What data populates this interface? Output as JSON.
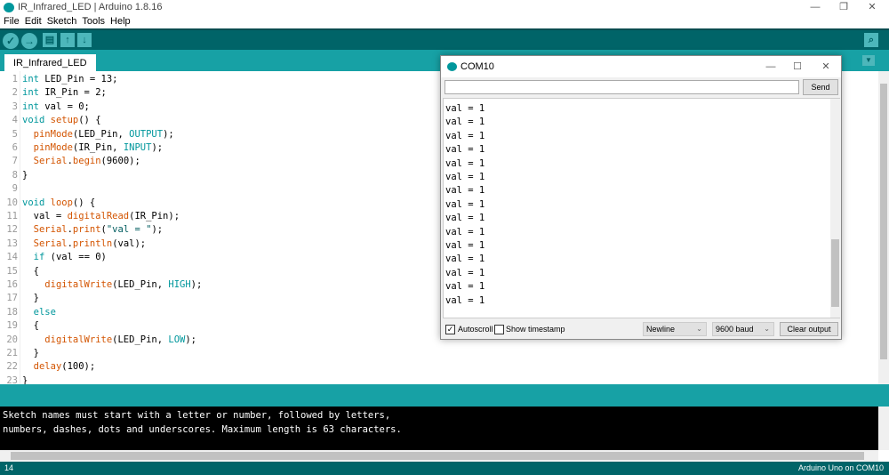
{
  "window": {
    "title": "IR_Infrared_LED | Arduino 1.8.16"
  },
  "menu": [
    "File",
    "Edit",
    "Sketch",
    "Tools",
    "Help"
  ],
  "toolbar": {
    "verify": "✓",
    "upload": "→",
    "new": "▤",
    "open": "↑",
    "save": "↓",
    "serial_monitor": "⌕"
  },
  "tab": {
    "label": "IR_Infrared_LED",
    "menu": "▼"
  },
  "code": [
    [
      [
        "k",
        "int"
      ],
      [
        "",
        "LED_Pin = 13;"
      ]
    ],
    [
      [
        "k",
        "int"
      ],
      [
        "",
        "IR_Pin = 2;"
      ]
    ],
    [
      [
        "k",
        "int"
      ],
      [
        "",
        "val = 0;"
      ]
    ],
    [
      [
        "k",
        "void"
      ],
      [
        "",
        " "
      ],
      [
        "f",
        "setup"
      ],
      [
        "",
        "() {"
      ]
    ],
    [
      [
        "",
        "  "
      ],
      [
        "f",
        "pinMode"
      ],
      [
        "",
        "(LED_Pin, "
      ],
      [
        "c",
        "OUTPUT"
      ],
      [
        "",
        ");"
      ]
    ],
    [
      [
        "",
        "  "
      ],
      [
        "f",
        "pinMode"
      ],
      [
        "",
        "(IR_Pin, "
      ],
      [
        "c",
        "INPUT"
      ],
      [
        "",
        ");"
      ]
    ],
    [
      [
        "",
        "  "
      ],
      [
        "f",
        "Serial"
      ],
      [
        "",
        "."
      ],
      [
        "f",
        "begin"
      ],
      [
        "",
        "(9600);"
      ]
    ],
    [
      [
        "",
        "}"
      ]
    ],
    [],
    [
      [
        "k",
        "void"
      ],
      [
        "",
        " "
      ],
      [
        "f",
        "loop"
      ],
      [
        "",
        "() {"
      ]
    ],
    [
      [
        "",
        "  val = "
      ],
      [
        "f",
        "digitalRead"
      ],
      [
        "",
        "(IR_Pin);"
      ]
    ],
    [
      [
        "",
        "  "
      ],
      [
        "f",
        "Serial"
      ],
      [
        "",
        "."
      ],
      [
        "f",
        "print"
      ],
      [
        "",
        "("
      ],
      [
        "s",
        "\"val = \""
      ],
      [
        "",
        ");"
      ]
    ],
    [
      [
        "",
        "  "
      ],
      [
        "f",
        "Serial"
      ],
      [
        "",
        "."
      ],
      [
        "f",
        "println"
      ],
      [
        "",
        "(val);"
      ]
    ],
    [
      [
        "",
        "  "
      ],
      [
        "k",
        "if"
      ],
      [
        "",
        " (val == 0)"
      ]
    ],
    [
      [
        "",
        "  {"
      ]
    ],
    [
      [
        "",
        "    "
      ],
      [
        "f",
        "digitalWrite"
      ],
      [
        "",
        "(LED_Pin, "
      ],
      [
        "c",
        "HIGH"
      ],
      [
        "",
        ");"
      ]
    ],
    [
      [
        "",
        "  }"
      ]
    ],
    [
      [
        "",
        "  "
      ],
      [
        "k",
        "else"
      ]
    ],
    [
      [
        "",
        "  {"
      ]
    ],
    [
      [
        "",
        "    "
      ],
      [
        "f",
        "digitalWrite"
      ],
      [
        "",
        "(LED_Pin, "
      ],
      [
        "c",
        "LOW"
      ],
      [
        "",
        ");"
      ]
    ],
    [
      [
        "",
        "  }"
      ]
    ],
    [
      [
        "",
        "  "
      ],
      [
        "f",
        "delay"
      ],
      [
        "",
        "(100);"
      ]
    ],
    [
      [
        "",
        "}"
      ]
    ]
  ],
  "console": {
    "message": "Sketch names must start with a letter or number, followed by letters,\nnumbers, dashes, dots and underscores. Maximum length is 63 characters."
  },
  "status": {
    "line": "14",
    "board": "Arduino Uno on COM10"
  },
  "serial_monitor": {
    "title": "COM10",
    "input_value": "",
    "send": "Send",
    "output": [
      "val = 1",
      "val = 1",
      "val = 1",
      "val = 1",
      "val = 1",
      "val = 1",
      "val = 1",
      "val = 1",
      "val = 1",
      "val = 1",
      "val = 1",
      "val = 1",
      "val = 1",
      "val = 1",
      "val = 1"
    ],
    "autoscroll": "Autoscroll",
    "autoscroll_checked": true,
    "timestamp": "Show timestamp",
    "timestamp_checked": false,
    "line_ending": "Newline",
    "baud": "9600 baud",
    "clear": "Clear output"
  },
  "colors": {
    "toolbar": "#006468",
    "tabbar": "#17a1a5",
    "keyword": "#00979c",
    "function": "#d35400"
  }
}
